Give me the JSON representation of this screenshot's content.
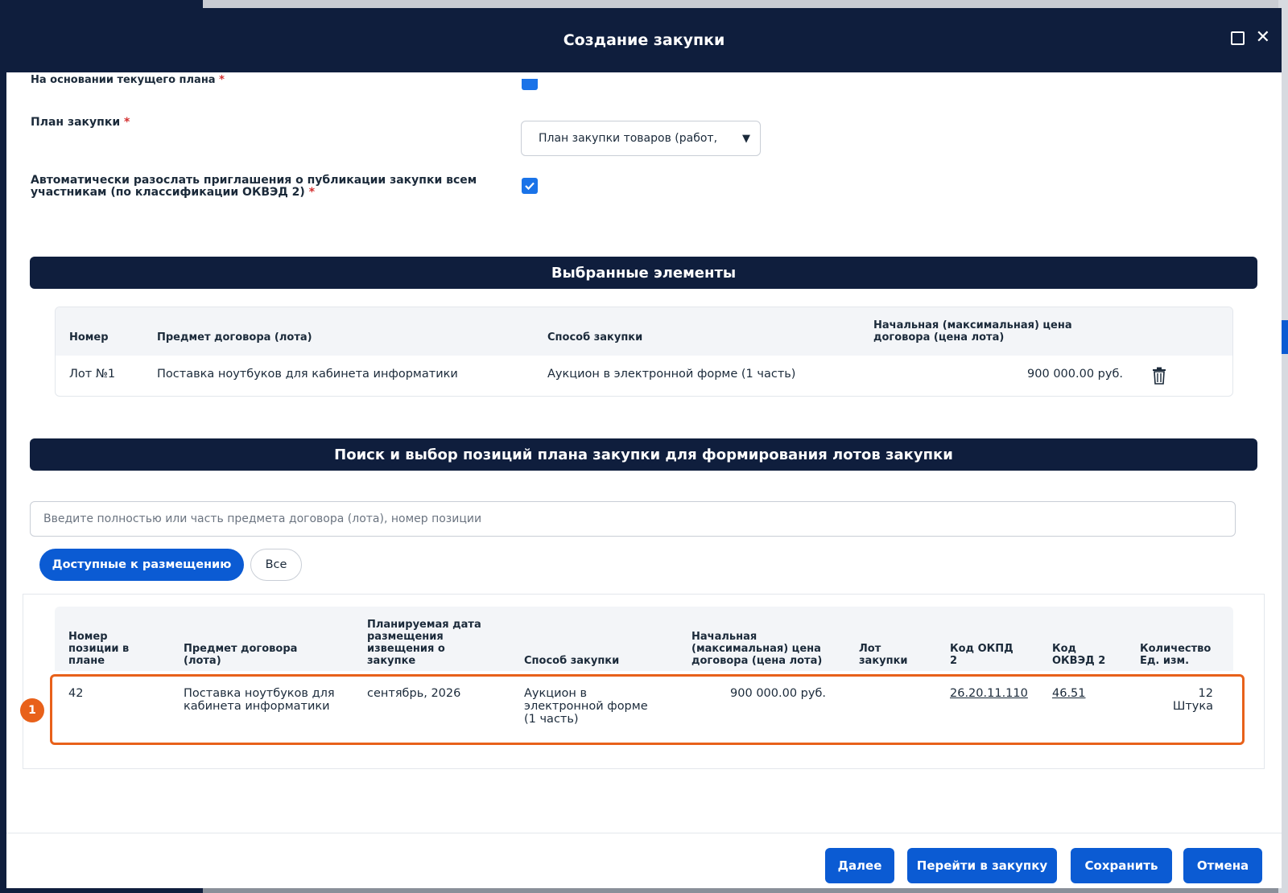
{
  "modal": {
    "title": "Создание закупки"
  },
  "form": {
    "cut_label": "На основании текущего плана",
    "plan_label": "План закупки",
    "plan_selected": "План закупки товаров (работ,",
    "auto_label_line1": "Автоматически разослать приглашения о публикации закупки всем",
    "auto_label_line2": "участникам (по классификации ОКВЭД 2)",
    "required_mark": "*"
  },
  "selected": {
    "title": "Выбранные элементы",
    "headers": {
      "number": "Номер",
      "subject": "Предмет договора (лота)",
      "method": "Способ закупки",
      "price_line1": "Начальная (максимальная) цена",
      "price_line2": "договора (цена лота)"
    },
    "rows": [
      {
        "number": "Лот №1",
        "subject": "Поставка ноутбуков для кабинета информатики",
        "method": "Аукцион в электронной форме (1 часть)",
        "price": "900 000.00 руб."
      }
    ]
  },
  "search": {
    "title": "Поиск и выбор позиций плана закупки для формирования лотов закупки",
    "placeholder": "Введите полностью или часть предмета договора (лота), номер позиции",
    "filter_available": "Доступные к размещению",
    "filter_all": "Все"
  },
  "positions": {
    "headers": {
      "num_l1": "Номер",
      "num_l2": "позиции в",
      "num_l3": "плане",
      "subj_l1": "Предмет договора",
      "subj_l2": "(лота)",
      "date_l1": "Планируемая дата",
      "date_l2": "размещения",
      "date_l3": "извещения о",
      "date_l4": "закупке",
      "method": "Способ закупки",
      "price_l1": "Начальная",
      "price_l2": "(максимальная) цена",
      "price_l3": "договора (цена лота)",
      "lot_l1": "Лот",
      "lot_l2": "закупки",
      "okpd_l1": "Код ОКПД",
      "okpd_l2": "2",
      "okved_l1": "Код",
      "okved_l2": "ОКВЭД 2",
      "qty_l1": "Количество",
      "qty_l2": "Ед. изм."
    },
    "rows": [
      {
        "num": "42",
        "subj_l1": "Поставка ноутбуков для",
        "subj_l2": "кабинета информатики",
        "date": "сентябрь, 2026",
        "method_l1": "Аукцион в",
        "method_l2": "электронной форме",
        "method_l3": "(1 часть)",
        "price": "900 000.00 руб.",
        "okpd": "26.20.11.110",
        "okved": "46.51",
        "qty": "12",
        "unit": "Штука"
      }
    ],
    "highlight_badge": "1"
  },
  "footer": {
    "next": "Далее",
    "goto": "Перейти в закупку",
    "save": "Сохранить",
    "cancel": "Отмена"
  },
  "colors": {
    "header_bg": "#0f1e3d",
    "primary": "#0b5bd3",
    "highlight": "#e8611a"
  }
}
